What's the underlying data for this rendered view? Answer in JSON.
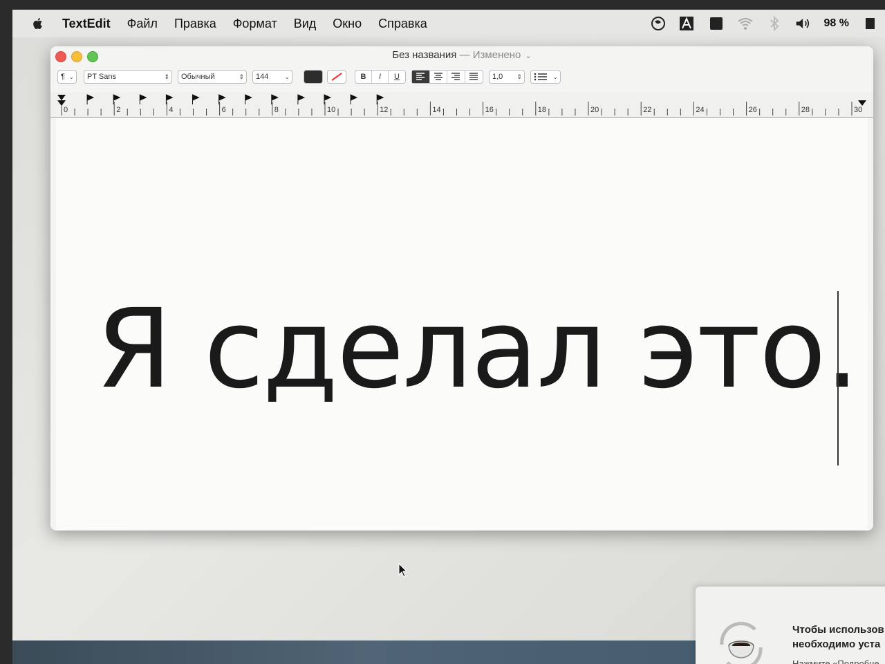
{
  "menubar": {
    "app_name": "TextEdit",
    "items": [
      "Файл",
      "Правка",
      "Формат",
      "Вид",
      "Окно",
      "Справка"
    ],
    "battery": "98 %"
  },
  "window": {
    "title": "Без названия",
    "separator": "—",
    "status": "Изменено"
  },
  "toolbar": {
    "paragraph_style": "¶",
    "font": "PT Sans",
    "typeface": "Обычный",
    "size": "144",
    "bold": "B",
    "italic": "I",
    "underline": "U",
    "line_spacing": "1,0",
    "text_color": "#1a1a1a"
  },
  "ruler": {
    "numbers": [
      "0",
      "2",
      "4",
      "6",
      "8",
      "10",
      "12",
      "14",
      "16",
      "18",
      "20",
      "22",
      "24",
      "26",
      "28",
      "30"
    ]
  },
  "document": {
    "text": "Я сделал это."
  },
  "notification": {
    "line1": "Чтобы использов",
    "line2": "необходимо уста",
    "line3": "Нажмите «Подробне"
  }
}
